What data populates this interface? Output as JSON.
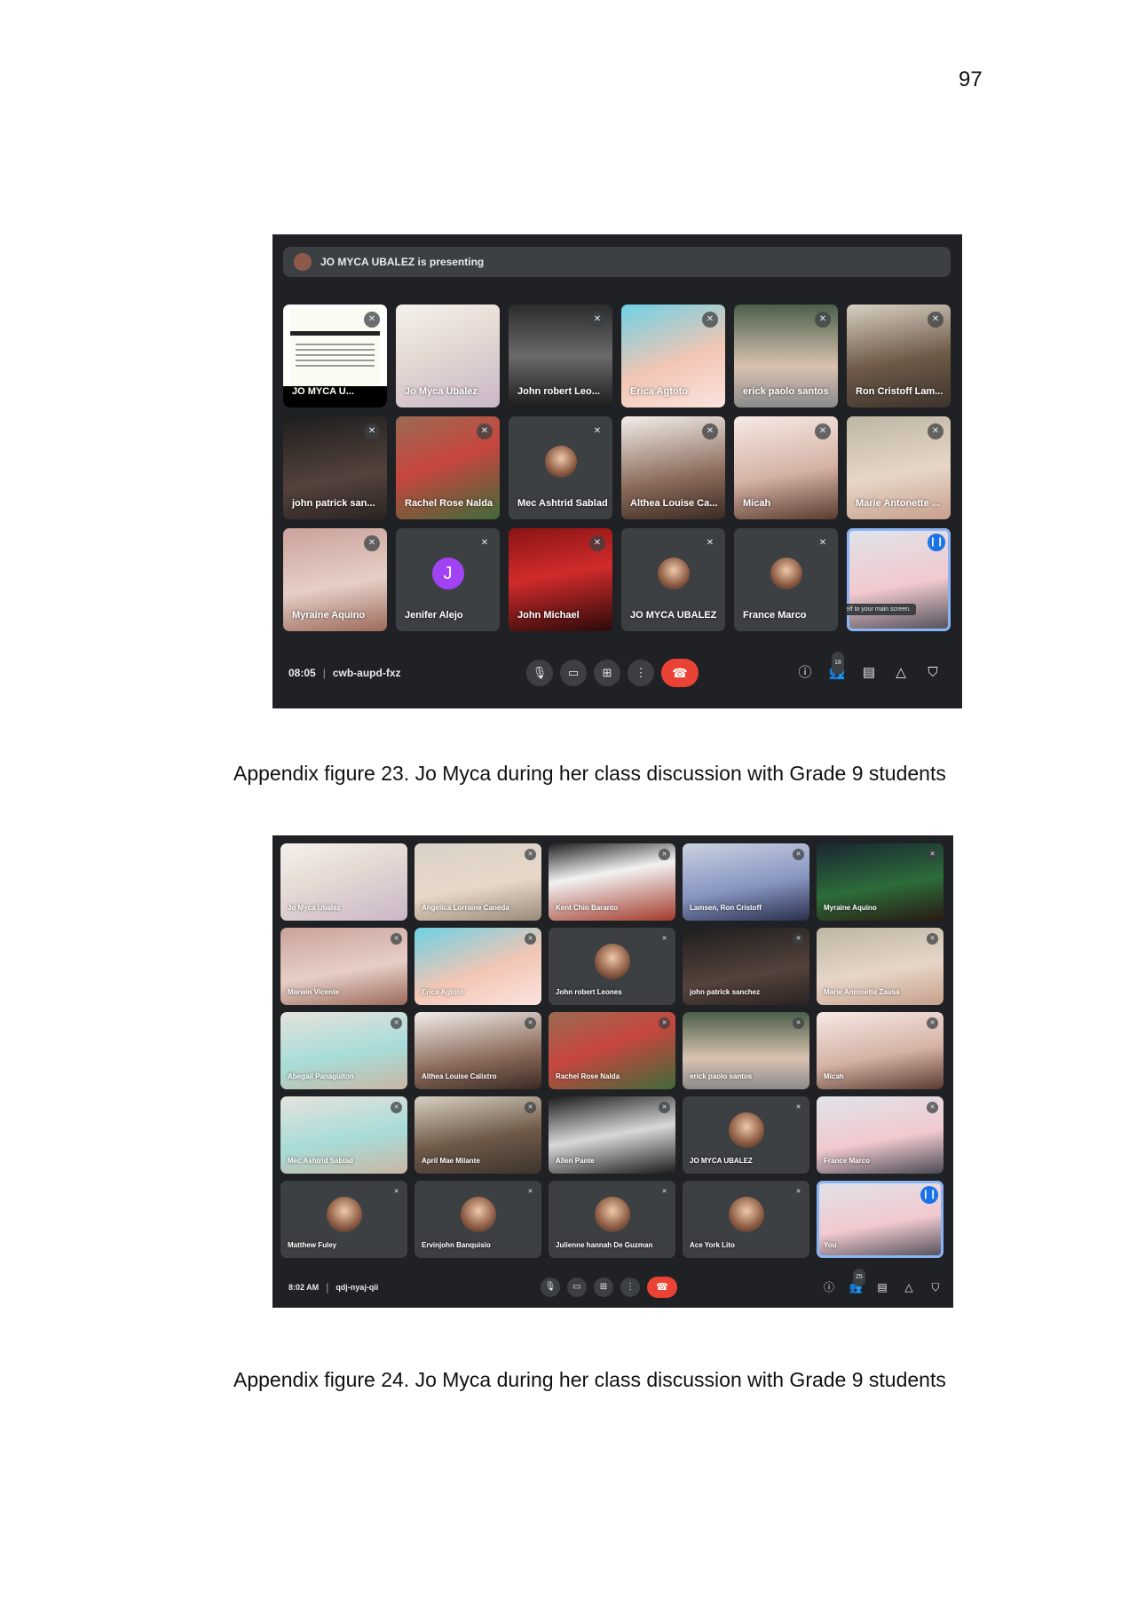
{
  "page_number": "97",
  "figure1": {
    "presenting_text": "JO MYCA UBALEZ is presenting",
    "tiles": [
      {
        "name": "JO MYCA U...",
        "muted": true,
        "type": "presentation"
      },
      {
        "name": "Jo Myca Ubalez",
        "muted": false,
        "bg": "bg-a"
      },
      {
        "name": "John robert Leo...",
        "muted": true,
        "bg": "bg-b"
      },
      {
        "name": "Erica Agtoto",
        "muted": true,
        "bg": "bg-c"
      },
      {
        "name": "erick paolo santos",
        "muted": true,
        "bg": "bg-d"
      },
      {
        "name": "Ron Cristoff Lam...",
        "muted": true,
        "bg": "bg-e"
      },
      {
        "name": "john patrick san...",
        "muted": true,
        "bg": "bg-f"
      },
      {
        "name": "Rachel Rose Nalda",
        "muted": true,
        "bg": "bg-g"
      },
      {
        "name": "Mec Ashtrid Sablad",
        "muted": true,
        "avatar": true
      },
      {
        "name": "Althea Louise Ca...",
        "muted": true,
        "bg": "bg-i"
      },
      {
        "name": "Micah",
        "muted": true,
        "bg": "bg-k"
      },
      {
        "name": "Marie Antonette ...",
        "muted": true,
        "bg": "bg-j"
      },
      {
        "name": "Myraine Aquino",
        "muted": true,
        "bg": "bg-h"
      },
      {
        "name": "Jenifer Alejo",
        "muted": true,
        "letter": "J"
      },
      {
        "name": "John Michael",
        "muted": true,
        "bg": "bg-l"
      },
      {
        "name": "JO MYCA UBALEZ",
        "muted": true,
        "avatar": true
      },
      {
        "name": "France Marco",
        "muted": true,
        "avatar": true
      },
      {
        "name": "",
        "muted": false,
        "bg": "bg-m",
        "self": true
      }
    ],
    "tooltip": "Pin yourself to your main screen.",
    "time": "08:05",
    "meeting_code": "cwb-aupd-fxz",
    "participant_count": "18",
    "caption": "Appendix figure 23. Jo Myca during her class discussion with Grade 9 students"
  },
  "figure2": {
    "tiles": [
      {
        "name": "Jo Myca Ubalez",
        "muted": false,
        "bg": "bg-a"
      },
      {
        "name": "Angelica Lorraine Caneda",
        "muted": true,
        "bg": "bg-t"
      },
      {
        "name": "Kent Chin Baranto",
        "muted": true,
        "bg": "bg-s"
      },
      {
        "name": "Lamsen, Ron Cristoff",
        "muted": true,
        "bg": "bg-o"
      },
      {
        "name": "Myraine Aquino",
        "muted": true,
        "bg": "bg-p"
      },
      {
        "name": "Marwin Vicente",
        "muted": true,
        "bg": "bg-h"
      },
      {
        "name": "Erica Agtoto",
        "muted": true,
        "bg": "bg-c"
      },
      {
        "name": "John robert Leones",
        "muted": true,
        "avatar": true
      },
      {
        "name": "john patrick sanchez",
        "muted": true,
        "bg": "bg-f"
      },
      {
        "name": "Marie Antonette Zausa",
        "muted": true,
        "bg": "bg-j"
      },
      {
        "name": "Abegail Panaguiton",
        "muted": true,
        "bg": "bg-r"
      },
      {
        "name": "Althea Louise Calixtro",
        "muted": true,
        "bg": "bg-i"
      },
      {
        "name": "Rachel Rose Nalda",
        "muted": true,
        "bg": "bg-g"
      },
      {
        "name": "erick paolo santos",
        "muted": true,
        "bg": "bg-d"
      },
      {
        "name": "Micah",
        "muted": true,
        "bg": "bg-k"
      },
      {
        "name": "Mec Ashtrid Sablad",
        "muted": true,
        "bg": "bg-r"
      },
      {
        "name": "April Mae Milante",
        "muted": true,
        "bg": "bg-e"
      },
      {
        "name": "Allen Pante",
        "muted": true,
        "bg": "bg-q"
      },
      {
        "name": "JO MYCA UBALEZ",
        "muted": true,
        "avatar": true
      },
      {
        "name": "France Marco",
        "muted": true,
        "bg": "bg-m"
      },
      {
        "name": "Matthew Fuley",
        "muted": true,
        "avatar": true
      },
      {
        "name": "Ervinjohn Banquisio",
        "muted": true,
        "avatar": true
      },
      {
        "name": "Julienne hannah De Guzman",
        "muted": true,
        "avatar": true
      },
      {
        "name": "Ace York Lito",
        "muted": true,
        "avatar": true
      },
      {
        "name": "You",
        "muted": false,
        "bg": "bg-m",
        "self": true
      }
    ],
    "time": "8:02 AM",
    "meeting_code": "qdj-nyaj-qii",
    "participant_count": "25",
    "caption": "Appendix figure 24. Jo Myca during her class discussion with Grade 9 students"
  },
  "icons": {
    "mic": "mic-icon",
    "camera": "camera-icon",
    "present": "present-icon",
    "more": "more-icon",
    "end_call": "end-call-icon",
    "info": "info-icon",
    "people": "people-icon",
    "chat": "chat-icon",
    "activities": "activities-icon",
    "host_controls": "host-controls-icon",
    "muted": "mic-off-icon"
  },
  "colors": {
    "meet_bg": "#202124",
    "tile_bg": "#3c4043",
    "end_call": "#ea4335",
    "highlight": "#8ab4f8",
    "speaking": "#1a73e8"
  }
}
